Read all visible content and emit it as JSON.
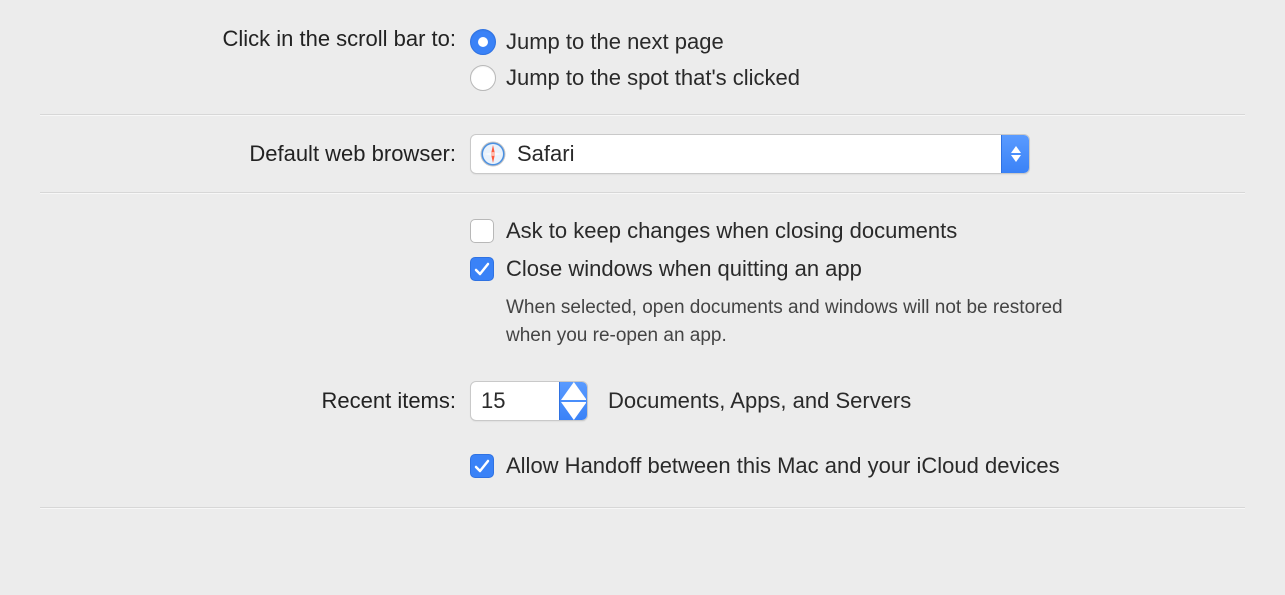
{
  "scroll": {
    "label": "Click in the scroll bar to:",
    "option1": "Jump to the next page",
    "option2": "Jump to the spot that's clicked",
    "selected": 0
  },
  "browser": {
    "label": "Default web browser:",
    "selected": "Safari"
  },
  "documents": {
    "ask_label": "Ask to keep changes when closing documents",
    "ask_checked": false,
    "close_label": "Close windows when quitting an app",
    "close_checked": true,
    "close_helper": "When selected, open documents and windows will not be restored when you re-open an app."
  },
  "recent": {
    "label": "Recent items:",
    "value": "15",
    "suffix": "Documents, Apps, and Servers"
  },
  "handoff": {
    "label": "Allow Handoff between this Mac and your iCloud devices",
    "checked": true
  }
}
